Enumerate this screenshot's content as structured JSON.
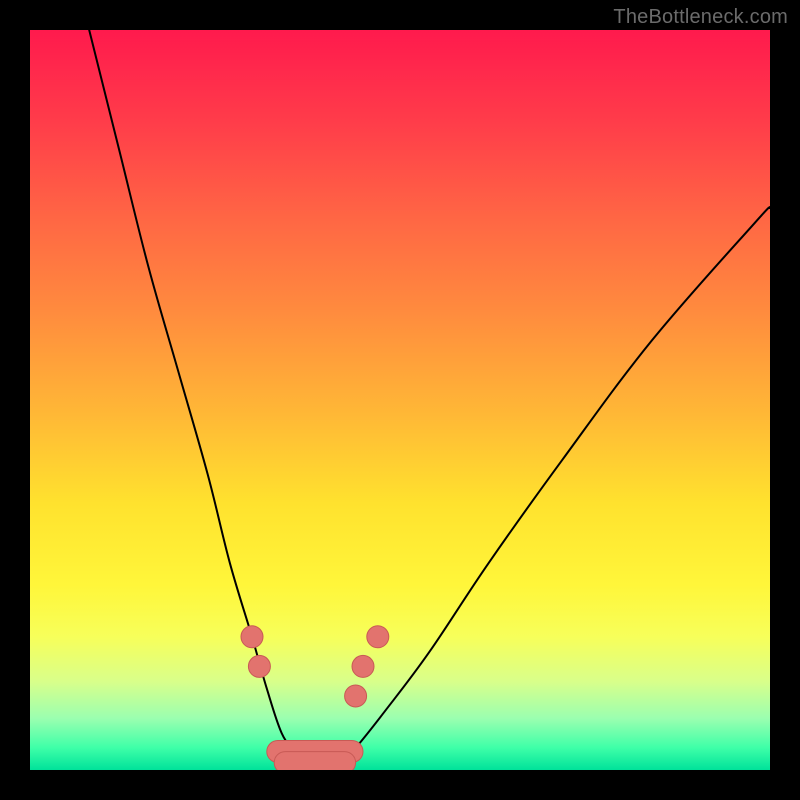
{
  "watermark": "TheBottleneck.com",
  "colors": {
    "background": "#000000",
    "gradient_top": "#ff1a4d",
    "gradient_bottom": "#00e29a",
    "curve": "#000000",
    "marker_fill": "#e2736e",
    "marker_stroke": "#c85a55"
  },
  "chart_data": {
    "type": "line",
    "title": "",
    "xlabel": "",
    "ylabel": "",
    "xlim": [
      0,
      100
    ],
    "ylim": [
      0,
      100
    ],
    "series": [
      {
        "name": "left-curve",
        "x": [
          8,
          12,
          16,
          20,
          24,
          27,
          30,
          32,
          34,
          36,
          37
        ],
        "y": [
          100,
          84,
          68,
          54,
          40,
          28,
          18,
          11,
          5,
          2,
          0
        ]
      },
      {
        "name": "right-curve",
        "x": [
          41,
          44,
          48,
          54,
          62,
          72,
          84,
          98,
          100
        ],
        "y": [
          0,
          3,
          8,
          16,
          28,
          42,
          58,
          74,
          76
        ]
      }
    ],
    "markers": [
      {
        "name": "left-dot-1",
        "x": 30,
        "y": 18
      },
      {
        "name": "left-dot-2",
        "x": 31,
        "y": 14
      },
      {
        "name": "right-dot-1",
        "x": 44,
        "y": 10
      },
      {
        "name": "right-dot-2",
        "x": 45,
        "y": 14
      },
      {
        "name": "right-dot-3",
        "x": 47,
        "y": 18
      }
    ],
    "baseline_cluster": {
      "segments": [
        {
          "x0": 32,
          "x1": 45,
          "y": 2.5
        },
        {
          "x0": 33,
          "x1": 44,
          "y": 1.0
        }
      ]
    }
  }
}
